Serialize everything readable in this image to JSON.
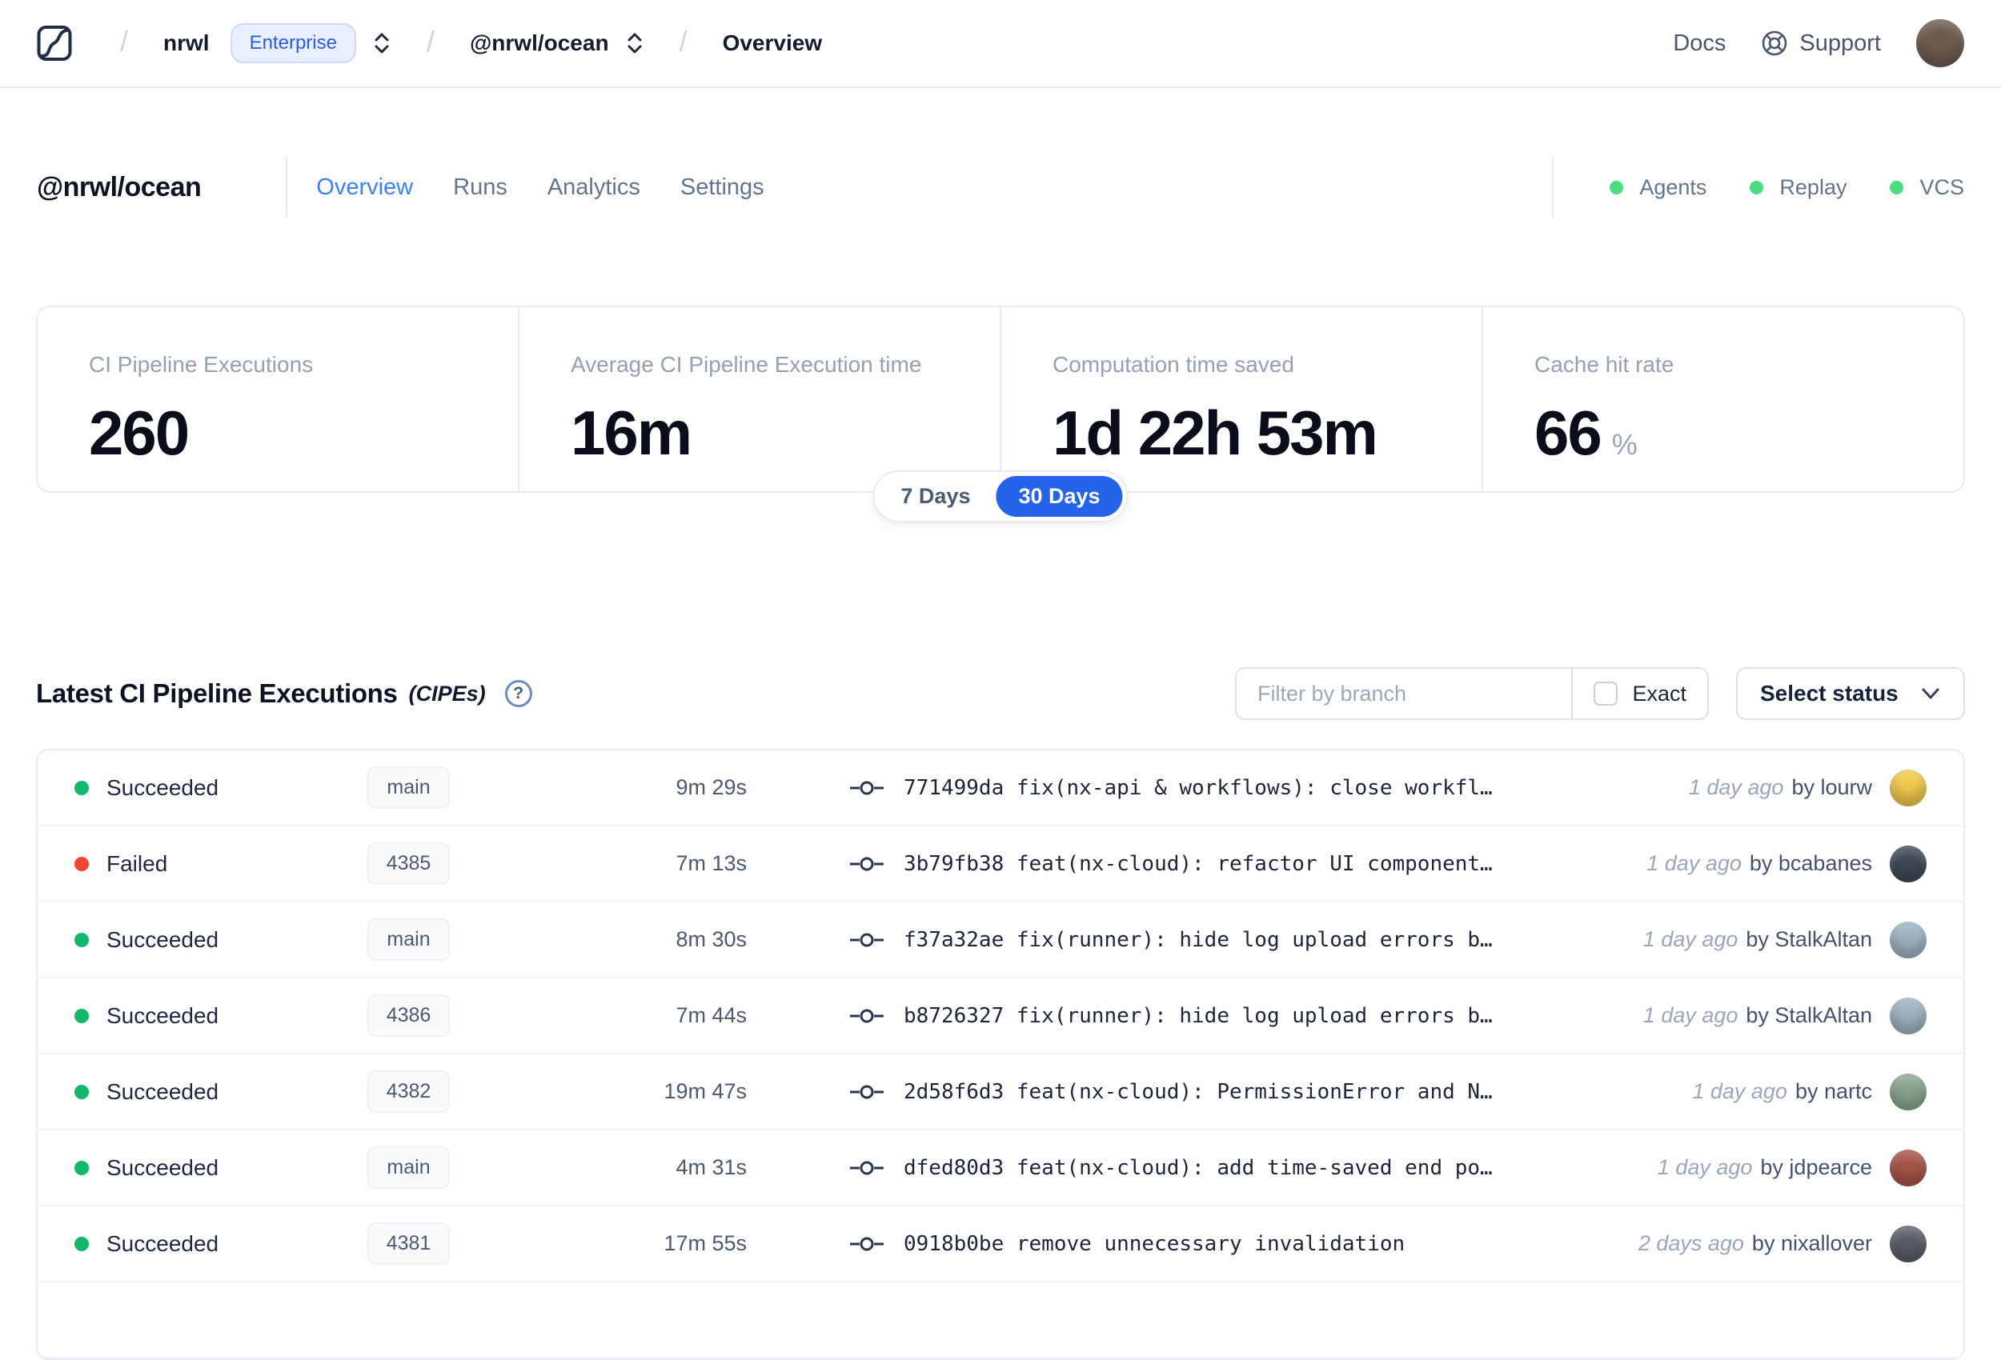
{
  "navbar": {
    "org": "nrwl",
    "plan_badge": "Enterprise",
    "workspace": "@nrwl/ocean",
    "page": "Overview",
    "docs": "Docs",
    "support": "Support"
  },
  "header": {
    "title": "@nrwl/ocean",
    "tabs": [
      "Overview",
      "Runs",
      "Analytics",
      "Settings"
    ],
    "active_tab": "Overview",
    "services": [
      {
        "label": "Agents"
      },
      {
        "label": "Replay"
      },
      {
        "label": "VCS"
      }
    ],
    "service_status_color": "#4ade80"
  },
  "stats": {
    "cards": [
      {
        "label": "CI Pipeline Executions",
        "value": "260",
        "suffix": ""
      },
      {
        "label": "Average CI Pipeline Execution time",
        "value": "16m",
        "suffix": ""
      },
      {
        "label": "Computation time saved",
        "value": "1d 22h 53m",
        "suffix": ""
      },
      {
        "label": "Cache hit rate",
        "value": "66",
        "suffix": "%"
      }
    ],
    "range_options": [
      "7 Days",
      "30 Days"
    ],
    "selected_range": "30 Days",
    "accent_color": "#2563eb"
  },
  "cipes": {
    "title": "Latest CI Pipeline Executions",
    "title_abbr": "(CIPEs)",
    "filter_placeholder": "Filter by branch",
    "exact_label": "Exact",
    "status_select_label": "Select status",
    "rows": [
      {
        "status": "Succeeded",
        "status_color": "#12b76a",
        "branch": "main",
        "duration": "9m 29s",
        "commit": "771499da fix(nx-api & workflows): close workfl…",
        "time_ago": "1 day ago",
        "author": "by lourw",
        "avatar_color": "#f2c94c"
      },
      {
        "status": "Failed",
        "status_color": "#f04438",
        "branch": "4385",
        "duration": "7m 13s",
        "commit": "3b79fb38 feat(nx-cloud): refactor UI component…",
        "time_ago": "1 day ago",
        "author": "by bcabanes",
        "avatar_color": "#3f4a56"
      },
      {
        "status": "Succeeded",
        "status_color": "#12b76a",
        "branch": "main",
        "duration": "8m 30s",
        "commit": "f37a32ae fix(runner): hide log upload errors b…",
        "time_ago": "1 day ago",
        "author": "by StalkAltan",
        "avatar_color": "#9fb4c2"
      },
      {
        "status": "Succeeded",
        "status_color": "#12b76a",
        "branch": "4386",
        "duration": "7m 44s",
        "commit": "b8726327 fix(runner): hide log upload errors b…",
        "time_ago": "1 day ago",
        "author": "by StalkAltan",
        "avatar_color": "#9fb4c2"
      },
      {
        "status": "Succeeded",
        "status_color": "#12b76a",
        "branch": "4382",
        "duration": "19m 47s",
        "commit": "2d58f6d3 feat(nx-cloud): PermissionError and N…",
        "time_ago": "1 day ago",
        "author": "by nartc",
        "avatar_color": "#8aa68f"
      },
      {
        "status": "Succeeded",
        "status_color": "#12b76a",
        "branch": "main",
        "duration": "4m 31s",
        "commit": "dfed80d3 feat(nx-cloud): add time-saved end po…",
        "time_ago": "1 day ago",
        "author": "by jdpearce",
        "avatar_color": "#a85448"
      },
      {
        "status": "Succeeded",
        "status_color": "#12b76a",
        "branch": "4381",
        "duration": "17m 55s",
        "commit": "0918b0be remove unnecessary invalidation",
        "time_ago": "2 days ago",
        "author": "by nixallover",
        "avatar_color": "#5a5f66"
      }
    ]
  }
}
